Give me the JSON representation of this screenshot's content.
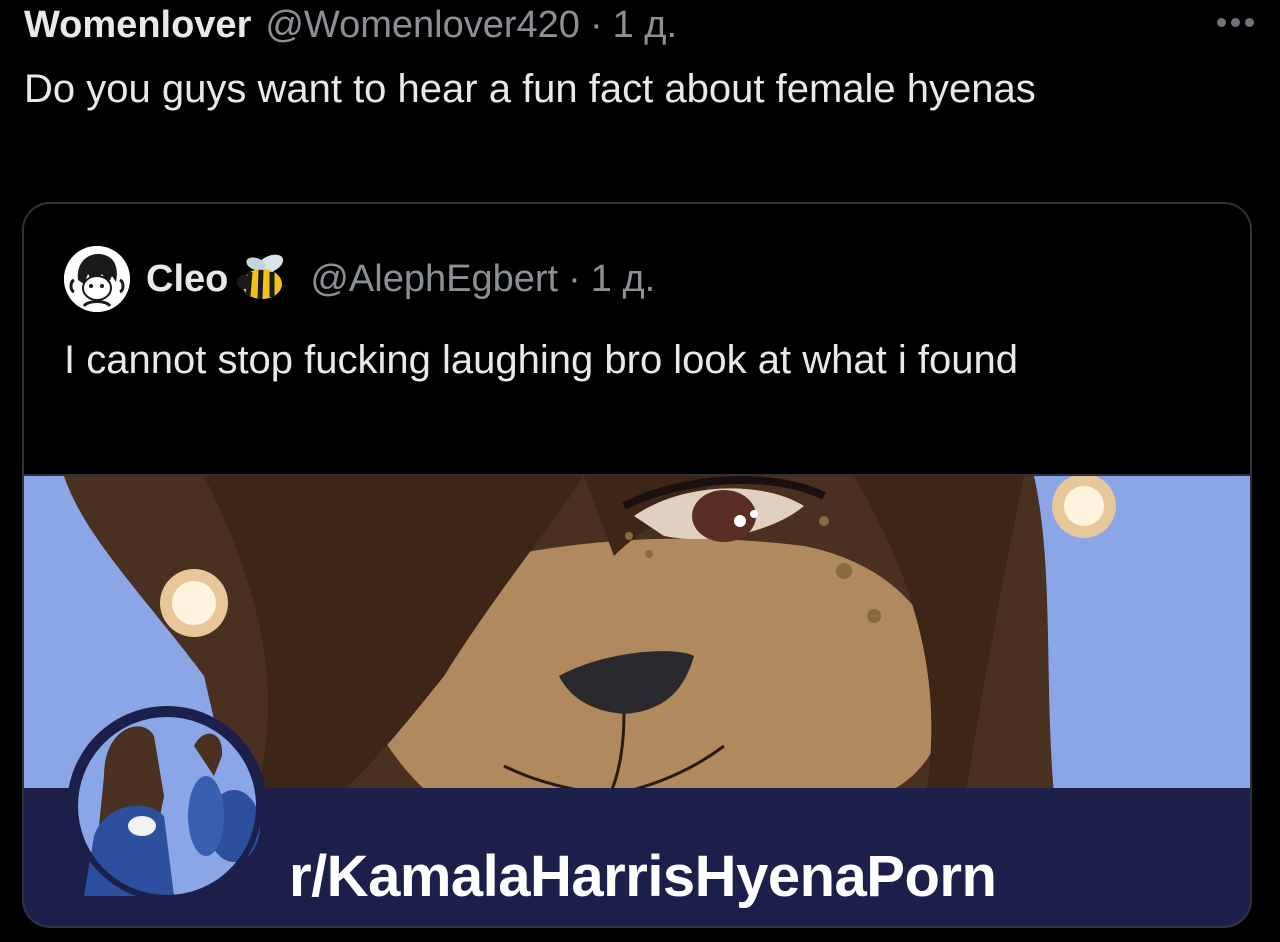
{
  "tweet": {
    "display_name": "Womenlover",
    "handle": "@Womenlover420",
    "separator": "·",
    "time": "1 д.",
    "text": "Do you guys want to hear a fun fact about female hyenas"
  },
  "quoted_tweet": {
    "display_name": "Cleo",
    "name_emoji": "bee-icon",
    "handle": "@AlephEgbert",
    "separator": "·",
    "time": "1 д.",
    "text": "I cannot stop fucking laughing bro look at what i found"
  },
  "media": {
    "banner_text": "r/KamalaHarrisHyenaPorn"
  },
  "colors": {
    "background": "#000000",
    "text_primary": "#e7e9ea",
    "text_secondary": "#8b9096",
    "card_border": "#2f3336",
    "image_sky": "#8aa6e6",
    "image_banner": "#1c1f4a"
  }
}
